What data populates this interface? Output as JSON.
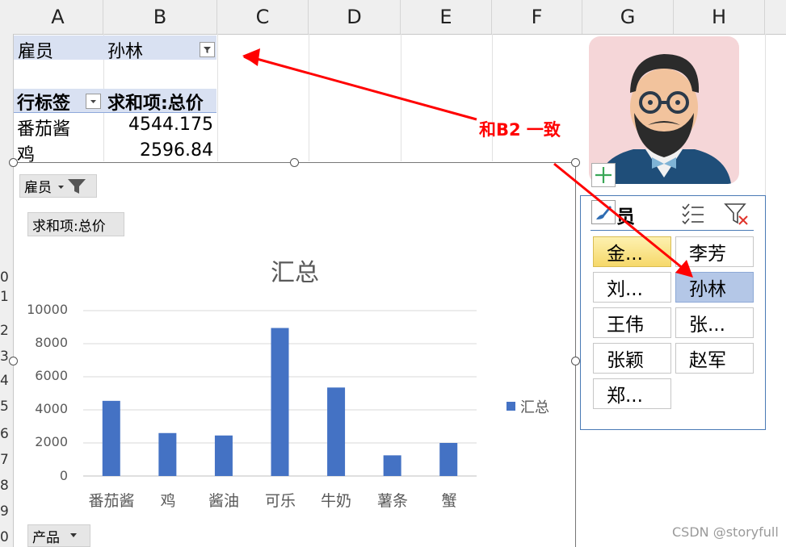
{
  "columns": [
    "A",
    "B",
    "C",
    "D",
    "E",
    "F",
    "G",
    "H"
  ],
  "row_numbers": [
    "0",
    "1",
    "2",
    "3",
    "4",
    "5",
    "6",
    "7",
    "8",
    "9",
    "0"
  ],
  "filter_row": {
    "label": "雇员",
    "value": "孙林"
  },
  "pivot": {
    "header_row_label": "行标签",
    "header_value_label": "求和项:总价",
    "rows": [
      {
        "label": "番茄酱",
        "value": "4544.175"
      },
      {
        "label": "鸡",
        "value": "2596.84"
      }
    ]
  },
  "chart": {
    "filter_button": "雇员",
    "value_field_button": "求和项:总价",
    "axis_field_button": "产品"
  },
  "chart_data": {
    "type": "bar",
    "title": "汇总",
    "categories": [
      "番茄酱",
      "鸡",
      "酱油",
      "可乐",
      "牛奶",
      "薯条",
      "蟹"
    ],
    "series": [
      {
        "name": "汇总",
        "values": [
          4544.175,
          2596.84,
          2450,
          8950,
          5350,
          1250,
          2000
        ]
      }
    ],
    "ylim": [
      0,
      10000
    ],
    "yticks": [
      "10000",
      "8000",
      "6000",
      "4000",
      "2000",
      "0"
    ],
    "grid": true,
    "legend": "right",
    "bar_color": "#4472c4"
  },
  "annotation": {
    "text": "和B2 一致",
    "color": "#ff0000"
  },
  "slicer": {
    "title": "员",
    "items": [
      {
        "label": "金...",
        "state": "gold"
      },
      {
        "label": "李芳",
        "state": "none"
      },
      {
        "label": "刘...",
        "state": "none"
      },
      {
        "label": "孙林",
        "state": "blue"
      },
      {
        "label": "王伟",
        "state": "none"
      },
      {
        "label": "张...",
        "state": "none"
      },
      {
        "label": "张颖",
        "state": "none"
      },
      {
        "label": "赵军",
        "state": "none"
      },
      {
        "label": "郑...",
        "state": "none"
      }
    ]
  },
  "watermark": "CSDN @storyfull"
}
